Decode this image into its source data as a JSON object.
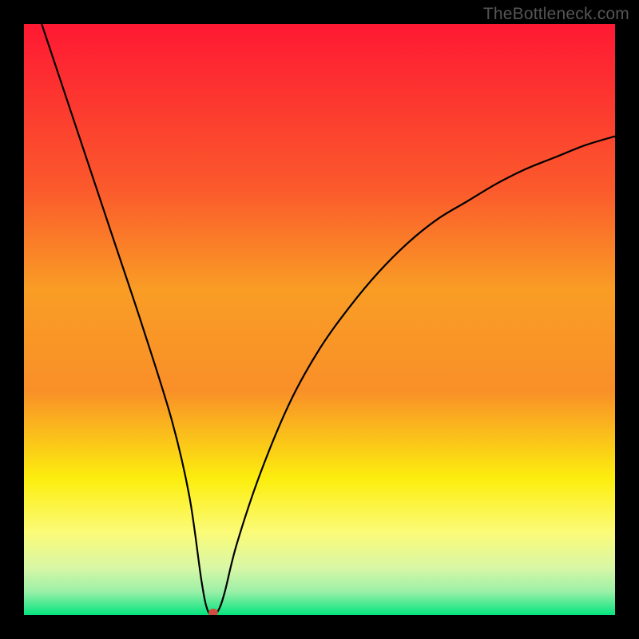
{
  "watermark": "TheBottleneck.com",
  "chart_data": {
    "type": "line",
    "title": "",
    "xlabel": "",
    "ylabel": "",
    "xlim": [
      0,
      100
    ],
    "ylim": [
      0,
      100
    ],
    "series": [
      {
        "name": "bottleneck-curve",
        "x": [
          3,
          5,
          10,
          15,
          20,
          25,
          28,
          30,
          31,
          32,
          33,
          34,
          36,
          40,
          45,
          50,
          55,
          60,
          65,
          70,
          75,
          80,
          85,
          90,
          95,
          100
        ],
        "values": [
          100,
          94,
          79,
          64,
          49,
          33,
          20,
          6,
          1,
          0,
          1,
          4,
          12,
          24,
          36,
          45,
          52,
          58,
          63,
          67,
          70,
          73,
          75.5,
          77.5,
          79.5,
          81
        ]
      }
    ],
    "minimum_point": {
      "x": 32,
      "y": 0
    },
    "background_gradient": {
      "top": "#fe1933",
      "mid_upper": "#f98f28",
      "mid": "#fcee0e",
      "mid_lower": "#fbfb78",
      "low": "#d8f7a5",
      "bottom": "#05e47f"
    }
  }
}
